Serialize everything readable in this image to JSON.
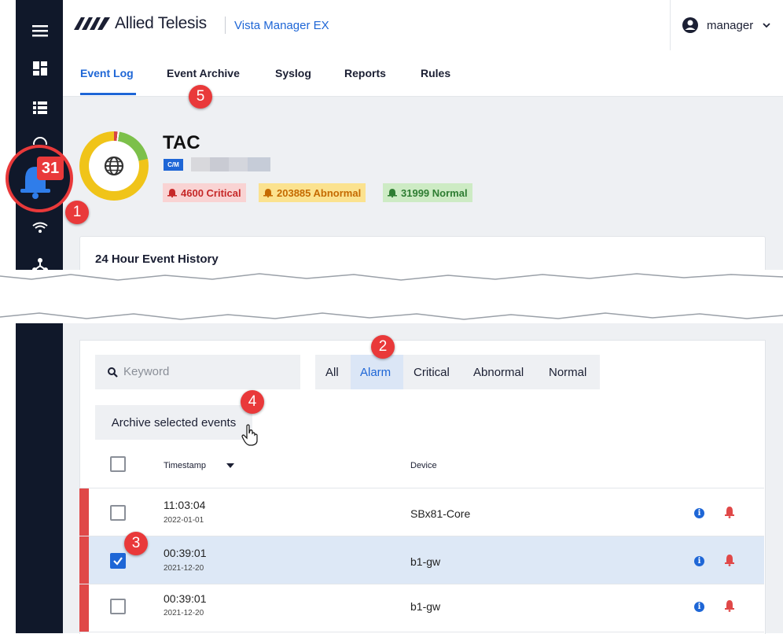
{
  "app": {
    "brand": "Allied Telesis",
    "product": "Vista Manager EX"
  },
  "user": {
    "name": "manager"
  },
  "sidebar": {
    "icons": [
      "menu-icon",
      "dashboard-icon",
      "list-icon",
      "globe-icon",
      "alarm-bell-icon",
      "wifi-icon",
      "topology-icon"
    ],
    "alarm_count": "31"
  },
  "tabs": [
    {
      "label": "Event Log",
      "active": true
    },
    {
      "label": "Event Archive"
    },
    {
      "label": "Syslog"
    },
    {
      "label": "Reports"
    },
    {
      "label": "Rules"
    }
  ],
  "site": {
    "name": "TAC",
    "tag": "C/M",
    "counts": {
      "critical": "4600 Critical",
      "abnormal": "203885 Abnormal",
      "normal": "31999 Normal"
    }
  },
  "history": {
    "title": "24 Hour Event History"
  },
  "filters": {
    "search_placeholder": "Keyword",
    "buttons": [
      "All",
      "Alarm",
      "Critical",
      "Abnormal",
      "Normal"
    ],
    "active": "Alarm"
  },
  "actions": {
    "archive": "Archive selected events"
  },
  "table": {
    "columns": {
      "timestamp": "Timestamp",
      "device": "Device"
    },
    "rows": [
      {
        "time": "11:03:04",
        "date": "2022-01-01",
        "device": "SBx81-Core",
        "selected": false
      },
      {
        "time": "00:39:01",
        "date": "2021-12-20",
        "device": "b1-gw",
        "selected": true
      },
      {
        "time": "00:39:01",
        "date": "2021-12-20",
        "device": "b1-gw",
        "selected": false
      }
    ]
  },
  "callouts": [
    "1",
    "2",
    "3",
    "4",
    "5"
  ],
  "colors": {
    "sidebar": "#10182a",
    "accent": "#1e66d6",
    "critical": "#e04848",
    "abnormal": "#f0c419",
    "normal": "#7cc04a",
    "callout": "#e9393a"
  }
}
